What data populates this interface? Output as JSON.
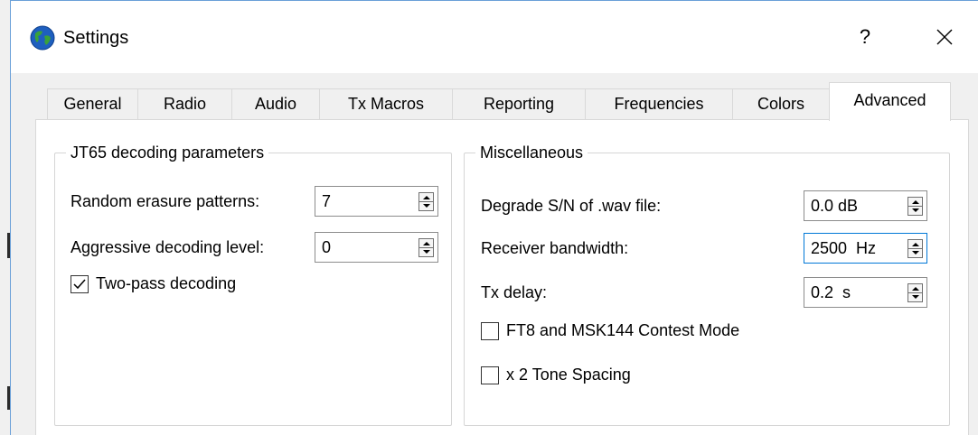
{
  "window": {
    "title": "Settings",
    "help_label": "?"
  },
  "tabs": [
    {
      "label": "General"
    },
    {
      "label": "Radio"
    },
    {
      "label": "Audio"
    },
    {
      "label": "Tx Macros"
    },
    {
      "label": "Reporting"
    },
    {
      "label": "Frequencies"
    },
    {
      "label": "Colors"
    },
    {
      "label": "Advanced"
    }
  ],
  "active_tab": "Advanced",
  "jt65": {
    "title": "JT65 decoding parameters",
    "random_erasure": {
      "label": "Random erasure patterns:",
      "value": "7"
    },
    "aggressive_level": {
      "label": "Aggressive decoding level:",
      "value": "0"
    },
    "two_pass": {
      "label": "Two-pass decoding",
      "checked": true
    }
  },
  "misc": {
    "title": "Miscellaneous",
    "degrade_sn": {
      "label": "Degrade S/N of .wav file:",
      "value": "0.0 dB"
    },
    "rx_bandwidth": {
      "label": "Receiver bandwidth:",
      "value": "2500  Hz"
    },
    "tx_delay": {
      "label": "Tx delay:",
      "value": "0.2  s"
    },
    "contest_mode": {
      "label": "FT8 and MSK144 Contest Mode",
      "checked": false
    },
    "tone_spacing": {
      "label": "x 2 Tone Spacing",
      "checked": false
    }
  },
  "colors": {
    "focus": "#0078d7",
    "window_border": "#6aa0d8"
  }
}
